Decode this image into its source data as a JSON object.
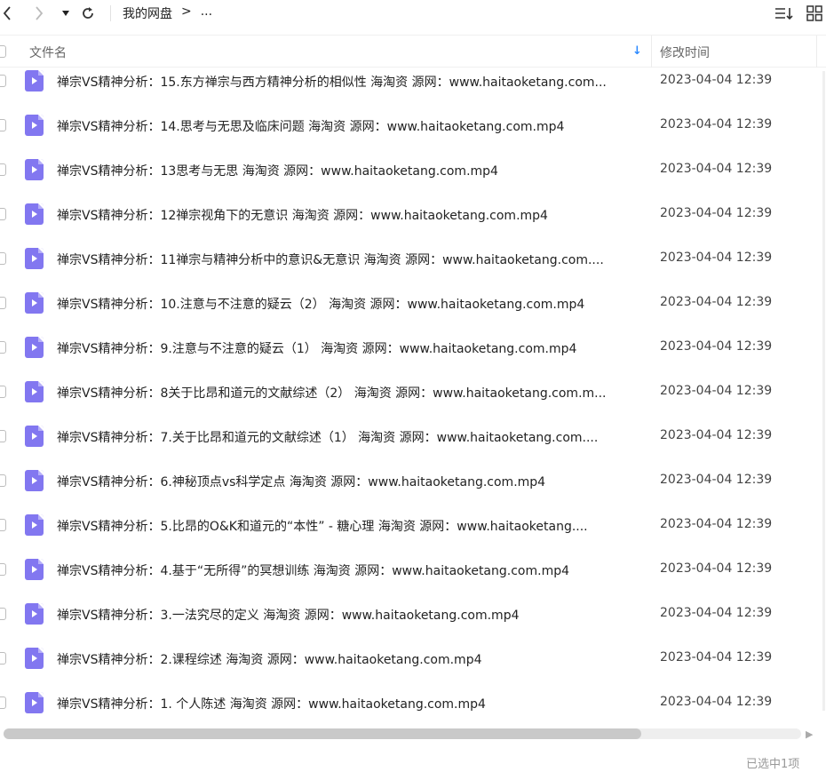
{
  "toolbar": {
    "breadcrumb": [
      "我的网盘",
      ">",
      "..."
    ],
    "icons": [
      "chevron-left-icon",
      "chevron-right-icon",
      "history-dropdown-icon",
      "refresh-icon",
      "sort-list-icon",
      "grid-view-icon"
    ]
  },
  "header": {
    "name_label": "文件名",
    "sort_arrow": "↓",
    "mtime_label": "修改时间"
  },
  "files": [
    {
      "name": "禅宗VS精神分析：15.东方禅宗与西方精神分析的相似性 海淘资 源网：www.haitaoketang.com...",
      "time": "2023-04-04 12:39"
    },
    {
      "name": "禅宗VS精神分析：14.思考与无思及临床问题 海淘资 源网：www.haitaoketang.com.mp4",
      "time": "2023-04-04 12:39"
    },
    {
      "name": "禅宗VS精神分析：13思考与无思 海淘资 源网：www.haitaoketang.com.mp4",
      "time": "2023-04-04 12:39"
    },
    {
      "name": "禅宗VS精神分析：12禅宗视角下的无意识 海淘资 源网：www.haitaoketang.com.mp4",
      "time": "2023-04-04 12:39"
    },
    {
      "name": "禅宗VS精神分析：11禅宗与精神分析中的意识&无意识 海淘资 源网：www.haitaoketang.com....",
      "time": "2023-04-04 12:39"
    },
    {
      "name": "禅宗VS精神分析：10.注意与不注意的疑云（2） 海淘资 源网：www.haitaoketang.com.mp4",
      "time": "2023-04-04 12:39"
    },
    {
      "name": "禅宗VS精神分析：9.注意与不注意的疑云（1） 海淘资 源网：www.haitaoketang.com.mp4",
      "time": "2023-04-04 12:39"
    },
    {
      "name": "禅宗VS精神分析：8关于比昂和道元的文献综述（2） 海淘资 源网：www.haitaoketang.com.m...",
      "time": "2023-04-04 12:39"
    },
    {
      "name": "禅宗VS精神分析：7.关于比昂和道元的文献综述（1）  海淘资 源网：www.haitaoketang.com....",
      "time": "2023-04-04 12:39"
    },
    {
      "name": "禅宗VS精神分析：6.神秘顶点vs科学定点 海淘资 源网：www.haitaoketang.com.mp4",
      "time": "2023-04-04 12:39"
    },
    {
      "name": "禅宗VS精神分析：5.比昂的O&K和道元的“本性” - 糖心理 海淘资 源网：www.haitaoketang....",
      "time": "2023-04-04 12:39"
    },
    {
      "name": "禅宗VS精神分析：4.基于“无所得”的冥想训练 海淘资 源网：www.haitaoketang.com.mp4",
      "time": "2023-04-04 12:39"
    },
    {
      "name": "禅宗VS精神分析：3.一法究尽的定义 海淘资 源网：www.haitaoketang.com.mp4",
      "time": "2023-04-04 12:39"
    },
    {
      "name": "禅宗VS精神分析：2.课程综述 海淘资 源网：www.haitaoketang.com.mp4",
      "time": "2023-04-04 12:39"
    },
    {
      "name": "禅宗VS精神分析：1. 个人陈述 海淘资 源网：www.haitaoketang.com.mp4",
      "time": "2023-04-04 12:39"
    }
  ],
  "scroll": {
    "horizontal_fraction_visible": 0.8
  },
  "status": {
    "selection_text": "已选中1项"
  },
  "colors": {
    "file_icon": "#8277f0",
    "sort_accent": "#2b89ff"
  }
}
